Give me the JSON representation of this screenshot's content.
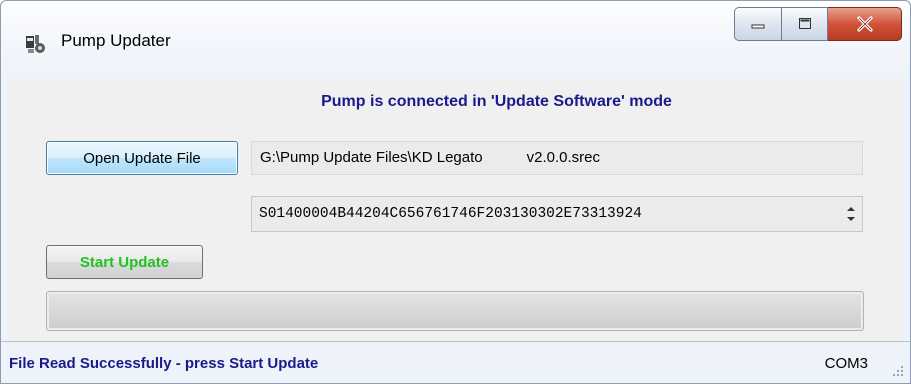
{
  "window": {
    "title": "Pump Updater",
    "icons": {
      "app": "pump-updater-app-icon",
      "minimize": "minimize-icon",
      "maximize": "maximize-icon",
      "close": "close-icon"
    }
  },
  "main": {
    "connection_message": "Pump is connected in 'Update Software' mode",
    "open_button_label": "Open Update File",
    "file_path_part1": "G:\\Pump Update Files\\KD Legato",
    "file_path_part2": "v2.0.0.srec",
    "record_value": "S01400004B44204C656761746F203130302E73313924",
    "start_button_label": "Start Update",
    "progress": 0
  },
  "status": {
    "message": "File Read Successfully - press Start Update",
    "port": "COM3"
  },
  "colors": {
    "message_blue": "#1a1a8c",
    "start_green": "#21c221",
    "close_red": "#c74a2f"
  }
}
